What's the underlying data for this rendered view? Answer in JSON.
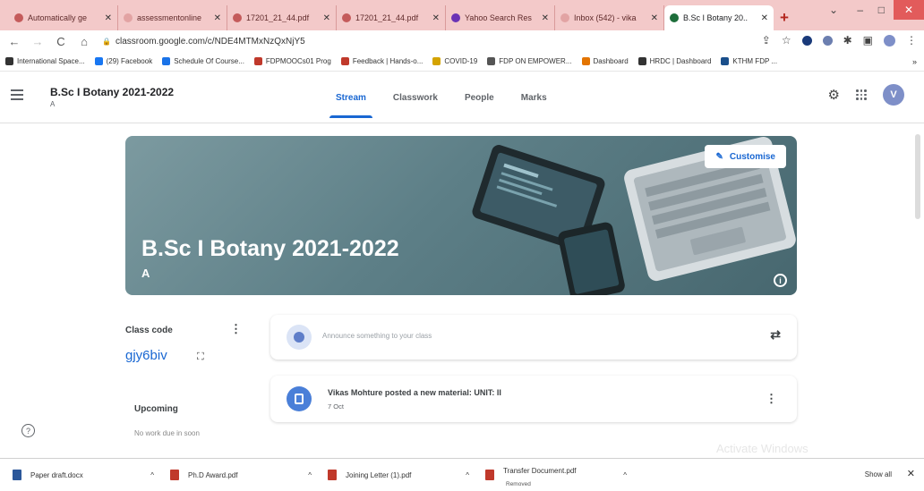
{
  "browser": {
    "tabs": [
      {
        "title": "Automatically ge",
        "color": "#c45b5b"
      },
      {
        "title": "assessmentonline",
        "color": "#e2a3a3"
      },
      {
        "title": "17201_21_44.pdf",
        "color": "#c45b5b"
      },
      {
        "title": "17201_21_44.pdf",
        "color": "#c45b5b"
      },
      {
        "title": "Yahoo Search Res",
        "color": "#6a33b5"
      },
      {
        "title": "Inbox (542) - vika",
        "color": "#e2a3a3"
      },
      {
        "title": "B.Sc I Botany 20..",
        "color": "#1e6e3b",
        "active": true
      }
    ],
    "new_tab": "+",
    "window_controls": {
      "dropdown": "⌄",
      "minimize": "–",
      "maximize": "□",
      "close": "✕"
    },
    "url": "classroom.google.com/c/NDE4MTMxNzQxNjY5",
    "nav": {
      "back": "←",
      "forward": "→",
      "reload": "C",
      "home": "⌂"
    },
    "bookmarks": [
      {
        "label": "International Space...",
        "color": "#333333"
      },
      {
        "label": "(29) Facebook",
        "color": "#1877f2"
      },
      {
        "label": "Schedule Of Course...",
        "color": "#1a73e8"
      },
      {
        "label": "FDPMOOCs01 Prog",
        "color": "#c0392b"
      },
      {
        "label": "Feedback | Hands-o...",
        "color": "#c0392b"
      },
      {
        "label": "COVID-19",
        "color": "#d4a300"
      },
      {
        "label": "FDP ON EMPOWER...",
        "color": "#555555"
      },
      {
        "label": "Dashboard",
        "color": "#e37400"
      },
      {
        "label": "HRDC | Dashboard",
        "color": "#333333"
      },
      {
        "label": "KTHM FDP ...",
        "color": "#1a4f8b"
      }
    ],
    "bookmarks_more": "»"
  },
  "classroom": {
    "title": "B.Sc I Botany 2021-2022",
    "section": "A",
    "tabs": [
      "Stream",
      "Classwork",
      "People",
      "Marks"
    ],
    "active_tab": "Stream",
    "avatar_letter": "V"
  },
  "banner": {
    "title": "B.Sc I Botany 2021-2022",
    "section": "A",
    "customise_label": "Customise",
    "info_symbol": "i"
  },
  "classcode": {
    "label": "Class code",
    "code": "gjy6biv",
    "more_symbol": "⋮",
    "expand_symbol": "⛶"
  },
  "upcoming": {
    "title": "Upcoming",
    "note": "No work due in soon"
  },
  "stream": {
    "announce_placeholder": "Announce something to your class",
    "post": {
      "title": "Vikas Mohture posted a new material: UNIT: II",
      "date": "7 Oct"
    },
    "more_symbol": "⋮",
    "repost_symbol": "⇄"
  },
  "help_symbol": "?",
  "watermark": "Activate Windows",
  "downloads": {
    "items": [
      {
        "name": "Paper draft.docx",
        "color": "#2b579a"
      },
      {
        "name": "Ph.D Award.pdf",
        "color": "#c0392b"
      },
      {
        "name": "Joining Letter (1).pdf",
        "color": "#c0392b"
      },
      {
        "name": "Transfer Document.pdf",
        "color": "#c0392b",
        "sub": "Removed"
      }
    ],
    "caret": "^",
    "show_all": "Show all",
    "close": "✕"
  }
}
